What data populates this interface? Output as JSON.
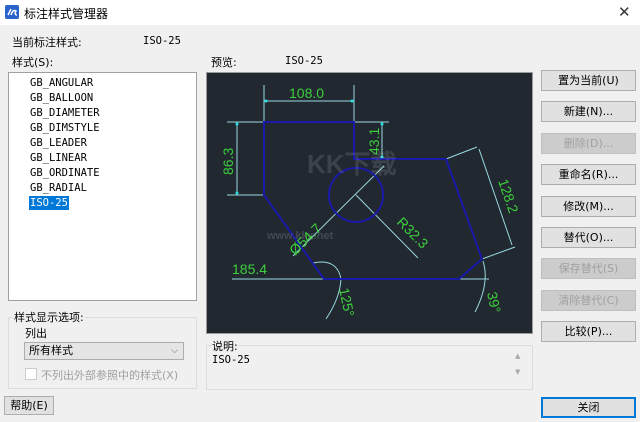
{
  "window": {
    "title": "标注样式管理器",
    "app_icon": "gstarcad-icon",
    "close_icon": "close-icon"
  },
  "current": {
    "label": "当前标注样式:",
    "value": "ISO-25"
  },
  "styles": {
    "label": "样式(S):",
    "items": [
      "GB_ANGULAR",
      "GB_BALLOON",
      "GB_DIAMETER",
      "GB_DIMSTYLE",
      "GB_LEADER",
      "GB_LINEAR",
      "GB_ORDINATE",
      "GB_RADIAL",
      "ISO-25"
    ],
    "selected": "ISO-25"
  },
  "preview": {
    "label": "预览:",
    "value": "ISO-25",
    "dims": {
      "top": "108.0",
      "left": "86.3",
      "step": "43.1",
      "slant": "128.2",
      "diameter": "Ø54.7",
      "radius": "R32.3",
      "base": "185.4",
      "angle1": "125°",
      "angle2": "39°"
    },
    "watermark": "www.kkx.net"
  },
  "display_options": {
    "label": "样式显示选项:",
    "list_label": "列出",
    "list_value": "所有样式",
    "exclude_xref_label": "不列出外部参照中的样式(X)",
    "exclude_xref_checked": false
  },
  "description": {
    "label": "说明:",
    "value": "ISO-25"
  },
  "buttons": {
    "set_current": "置为当前(U)",
    "new": "新建(N)...",
    "delete": "删除(D)...",
    "rename": "重命名(R)...",
    "modify": "修改(M)...",
    "override": "替代(O)...",
    "save_override": "保存替代(S)",
    "clear_override": "清除替代(C)",
    "compare": "比较(P)...",
    "help": "帮助(E)",
    "close": "关闭"
  },
  "colors": {
    "geometry": "#1a1aa8",
    "dim_text": "#3ccf3c",
    "dim_line": "#9ad9e0",
    "selection": "#0078d7"
  }
}
